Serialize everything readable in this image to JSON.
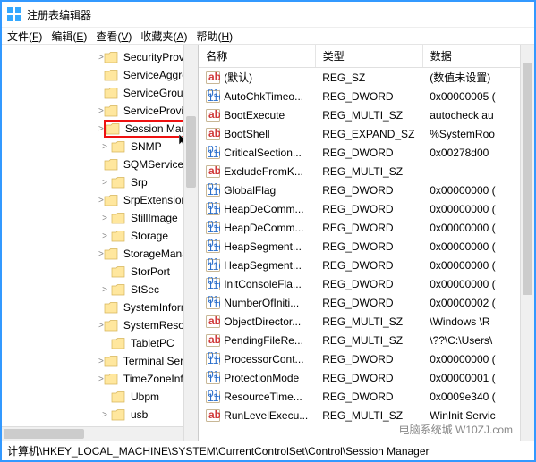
{
  "window": {
    "title": "注册表编辑器"
  },
  "menu": {
    "file": {
      "label": "文件",
      "accel": "F"
    },
    "edit": {
      "label": "编辑",
      "accel": "E"
    },
    "view": {
      "label": "查看",
      "accel": "V"
    },
    "fav": {
      "label": "收藏夹",
      "accel": "A"
    },
    "help": {
      "label": "帮助",
      "accel": "H"
    }
  },
  "tree_indent_base": 108,
  "tree": [
    {
      "label": "SecurityProviders",
      "expandable": true,
      "indent": 0
    },
    {
      "label": "ServiceAggregated",
      "expandable": false,
      "indent": 0
    },
    {
      "label": "ServiceGroupOrder",
      "expandable": false,
      "indent": 0
    },
    {
      "label": "ServiceProvider",
      "expandable": true,
      "indent": 0
    },
    {
      "label": "Session Manager",
      "expandable": true,
      "indent": 0,
      "selected": true
    },
    {
      "label": "SNMP",
      "expandable": true,
      "indent": 0
    },
    {
      "label": "SQMServiceList",
      "expandable": false,
      "indent": 0
    },
    {
      "label": "Srp",
      "expandable": true,
      "indent": 0
    },
    {
      "label": "SrpExtensionConfig",
      "expandable": true,
      "indent": 0
    },
    {
      "label": "StillImage",
      "expandable": true,
      "indent": 0
    },
    {
      "label": "Storage",
      "expandable": true,
      "indent": 0
    },
    {
      "label": "StorageManageme",
      "expandable": true,
      "indent": 0
    },
    {
      "label": "StorPort",
      "expandable": false,
      "indent": 0
    },
    {
      "label": "StSec",
      "expandable": true,
      "indent": 0
    },
    {
      "label": "SystemInformation",
      "expandable": false,
      "indent": 0
    },
    {
      "label": "SystemResources",
      "expandable": true,
      "indent": 0
    },
    {
      "label": "TabletPC",
      "expandable": false,
      "indent": 0
    },
    {
      "label": "Terminal Server",
      "expandable": true,
      "indent": 0
    },
    {
      "label": "TimeZoneInformati",
      "expandable": true,
      "indent": 0
    },
    {
      "label": "Ubpm",
      "expandable": false,
      "indent": 0
    },
    {
      "label": "usb",
      "expandable": true,
      "indent": 0
    }
  ],
  "columns": {
    "name": "名称",
    "type": "类型",
    "data": "数据"
  },
  "values": [
    {
      "icon": "sz",
      "name": "(默认)",
      "type": "REG_SZ",
      "data": "(数值未设置)"
    },
    {
      "icon": "bin",
      "name": "AutoChkTimeo...",
      "type": "REG_DWORD",
      "data": "0x00000005 ("
    },
    {
      "icon": "sz",
      "name": "BootExecute",
      "type": "REG_MULTI_SZ",
      "data": "autocheck au"
    },
    {
      "icon": "sz",
      "name": "BootShell",
      "type": "REG_EXPAND_SZ",
      "data": "%SystemRoo"
    },
    {
      "icon": "bin",
      "name": "CriticalSection...",
      "type": "REG_DWORD",
      "data": "0x00278d00 "
    },
    {
      "icon": "sz",
      "name": "ExcludeFromK...",
      "type": "REG_MULTI_SZ",
      "data": ""
    },
    {
      "icon": "bin",
      "name": "GlobalFlag",
      "type": "REG_DWORD",
      "data": "0x00000000 ("
    },
    {
      "icon": "bin",
      "name": "HeapDeComm...",
      "type": "REG_DWORD",
      "data": "0x00000000 ("
    },
    {
      "icon": "bin",
      "name": "HeapDeComm...",
      "type": "REG_DWORD",
      "data": "0x00000000 ("
    },
    {
      "icon": "bin",
      "name": "HeapSegment...",
      "type": "REG_DWORD",
      "data": "0x00000000 ("
    },
    {
      "icon": "bin",
      "name": "HeapSegment...",
      "type": "REG_DWORD",
      "data": "0x00000000 ("
    },
    {
      "icon": "bin",
      "name": "InitConsoleFla...",
      "type": "REG_DWORD",
      "data": "0x00000000 ("
    },
    {
      "icon": "bin",
      "name": "NumberOfIniti...",
      "type": "REG_DWORD",
      "data": "0x00000002 ("
    },
    {
      "icon": "sz",
      "name": "ObjectDirector...",
      "type": "REG_MULTI_SZ",
      "data": "\\Windows \\R"
    },
    {
      "icon": "sz",
      "name": "PendingFileRe...",
      "type": "REG_MULTI_SZ",
      "data": "\\??\\C:\\Users\\"
    },
    {
      "icon": "bin",
      "name": "ProcessorCont...",
      "type": "REG_DWORD",
      "data": "0x00000000 ("
    },
    {
      "icon": "bin",
      "name": "ProtectionMode",
      "type": "REG_DWORD",
      "data": "0x00000001 ("
    },
    {
      "icon": "bin",
      "name": "ResourceTime...",
      "type": "REG_DWORD",
      "data": "0x0009e340 ("
    },
    {
      "icon": "sz",
      "name": "RunLevelExecu...",
      "type": "REG_MULTI_SZ",
      "data": "WinInit Servic"
    }
  ],
  "statusbar": "计算机\\HKEY_LOCAL_MACHINE\\SYSTEM\\CurrentControlSet\\Control\\Session Manager",
  "watermark": "电脑系统城 W10ZJ.com"
}
